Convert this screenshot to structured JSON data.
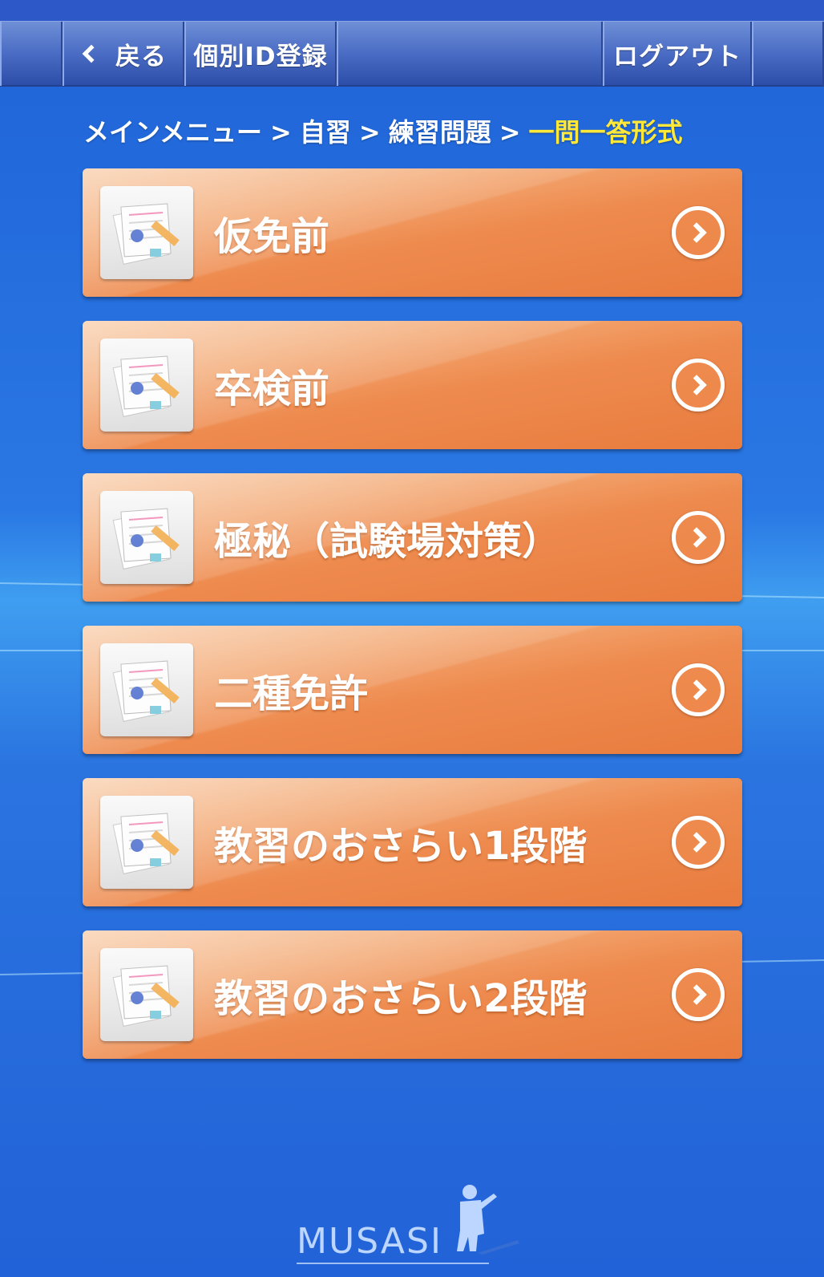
{
  "nav": {
    "back_label": "戻る",
    "register_label": "個別ID登録",
    "logout_label": "ログアウト"
  },
  "breadcrumb": {
    "items": [
      "メインメニュー",
      "自習",
      "練習問題"
    ],
    "separator": ">",
    "current": "一問一答形式"
  },
  "menu": [
    {
      "label": "仮免前"
    },
    {
      "label": "卒検前"
    },
    {
      "label": "極秘（試験場対策）"
    },
    {
      "label": "二種免許"
    },
    {
      "label": "教習のおさらい1段階"
    },
    {
      "label": "教習のおさらい2段階"
    }
  ],
  "footer": {
    "logo_text": "MUSASI"
  },
  "colors": {
    "accent": "#ee8a4e",
    "breadcrumb_current": "#ffe838",
    "background": "#2a74e0"
  }
}
